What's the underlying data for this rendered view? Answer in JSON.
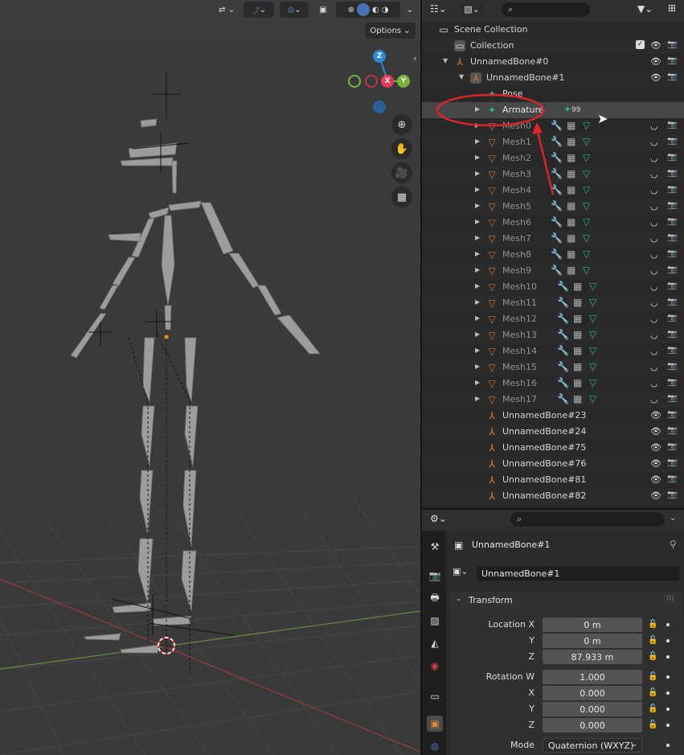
{
  "viewport": {
    "options_label": "Options",
    "gizmo": {
      "z": "Z",
      "x": "X",
      "y": "Y"
    },
    "nav_icons": [
      "zoom-icon",
      "hand-pan-icon",
      "camera-icon",
      "grid-ortho-icon"
    ]
  },
  "outliner": {
    "search_placeholder": "",
    "rows": [
      {
        "label": "Scene Collection",
        "type": "scene-collection",
        "indent": 0,
        "expander": "",
        "eye": false,
        "cam": false,
        "check": false,
        "dim": false
      },
      {
        "label": "Collection",
        "type": "collection",
        "indent": 1,
        "expander": "",
        "eye": true,
        "cam": true,
        "check": true,
        "dim": false
      },
      {
        "label": "UnnamedBone#0",
        "type": "empty",
        "indent": 1,
        "expander": "▼",
        "eye": true,
        "cam": true,
        "check": false,
        "dim": false
      },
      {
        "label": "UnnamedBone#1",
        "type": "armature-object",
        "indent": 2,
        "expander": "▼",
        "eye": true,
        "cam": true,
        "check": false,
        "dim": false
      },
      {
        "label": "Pose",
        "type": "pose",
        "indent": 3,
        "expander": "",
        "eye": false,
        "cam": false,
        "check": false,
        "dim": false
      },
      {
        "label": "Armature",
        "type": "armature-data",
        "indent": 3,
        "expander": "▶",
        "eye": false,
        "cam": false,
        "check": false,
        "dim": false,
        "selected": true,
        "suffix": "99"
      },
      {
        "label": "Mesh0",
        "type": "mesh",
        "indent": 3,
        "expander": "▶",
        "eye": "hidden",
        "cam": true,
        "dim": true
      },
      {
        "label": "Mesh1",
        "type": "mesh",
        "indent": 3,
        "expander": "▶",
        "eye": "hidden",
        "cam": true,
        "dim": true
      },
      {
        "label": "Mesh2",
        "type": "mesh",
        "indent": 3,
        "expander": "▶",
        "eye": "hidden",
        "cam": true,
        "dim": true
      },
      {
        "label": "Mesh3",
        "type": "mesh",
        "indent": 3,
        "expander": "▶",
        "eye": "hidden",
        "cam": true,
        "dim": true
      },
      {
        "label": "Mesh4",
        "type": "mesh",
        "indent": 3,
        "expander": "▶",
        "eye": "hidden",
        "cam": true,
        "dim": true
      },
      {
        "label": "Mesh5",
        "type": "mesh",
        "indent": 3,
        "expander": "▶",
        "eye": "hidden",
        "cam": true,
        "dim": true
      },
      {
        "label": "Mesh6",
        "type": "mesh",
        "indent": 3,
        "expander": "▶",
        "eye": "hidden",
        "cam": true,
        "dim": true
      },
      {
        "label": "Mesh7",
        "type": "mesh",
        "indent": 3,
        "expander": "▶",
        "eye": "hidden",
        "cam": true,
        "dim": true
      },
      {
        "label": "Mesh8",
        "type": "mesh",
        "indent": 3,
        "expander": "▶",
        "eye": "hidden",
        "cam": true,
        "dim": true
      },
      {
        "label": "Mesh9",
        "type": "mesh",
        "indent": 3,
        "expander": "▶",
        "eye": "hidden",
        "cam": true,
        "dim": true
      },
      {
        "label": "Mesh10",
        "type": "mesh",
        "indent": 3,
        "expander": "▶",
        "eye": "hidden",
        "cam": true,
        "dim": true
      },
      {
        "label": "Mesh11",
        "type": "mesh",
        "indent": 3,
        "expander": "▶",
        "eye": "hidden",
        "cam": true,
        "dim": true
      },
      {
        "label": "Mesh12",
        "type": "mesh",
        "indent": 3,
        "expander": "▶",
        "eye": "hidden",
        "cam": true,
        "dim": true
      },
      {
        "label": "Mesh13",
        "type": "mesh",
        "indent": 3,
        "expander": "▶",
        "eye": "hidden",
        "cam": true,
        "dim": true
      },
      {
        "label": "Mesh14",
        "type": "mesh",
        "indent": 3,
        "expander": "▶",
        "eye": "hidden",
        "cam": true,
        "dim": true
      },
      {
        "label": "Mesh15",
        "type": "mesh",
        "indent": 3,
        "expander": "▶",
        "eye": "hidden",
        "cam": true,
        "dim": true
      },
      {
        "label": "Mesh16",
        "type": "mesh",
        "indent": 3,
        "expander": "▶",
        "eye": "hidden",
        "cam": true,
        "dim": true
      },
      {
        "label": "Mesh17",
        "type": "mesh",
        "indent": 3,
        "expander": "▶",
        "eye": "hidden",
        "cam": true,
        "dim": true
      },
      {
        "label": "UnnamedBone#23",
        "type": "empty",
        "indent": 3,
        "expander": "",
        "eye": true,
        "cam": true,
        "dim": false
      },
      {
        "label": "UnnamedBone#24",
        "type": "empty",
        "indent": 3,
        "expander": "",
        "eye": true,
        "cam": true,
        "dim": false
      },
      {
        "label": "UnnamedBone#75",
        "type": "empty",
        "indent": 3,
        "expander": "",
        "eye": true,
        "cam": true,
        "dim": false
      },
      {
        "label": "UnnamedBone#76",
        "type": "empty",
        "indent": 3,
        "expander": "",
        "eye": true,
        "cam": true,
        "dim": false
      },
      {
        "label": "UnnamedBone#81",
        "type": "empty",
        "indent": 3,
        "expander": "",
        "eye": true,
        "cam": true,
        "dim": false
      },
      {
        "label": "UnnamedBone#82",
        "type": "empty",
        "indent": 3,
        "expander": "",
        "eye": true,
        "cam": true,
        "dim": false
      }
    ]
  },
  "properties": {
    "search_placeholder": "",
    "object_name": "UnnamedBone#1",
    "name_field": "UnnamedBone#1",
    "panel_title": "Transform",
    "location": {
      "label": "Location X",
      "x": "0 m",
      "y": "0 m",
      "z": "87.933 m"
    },
    "rotation": {
      "label": "Rotation W",
      "w": "1.000",
      "x": "0.000",
      "y": "0.000",
      "z": "0.000"
    },
    "axis_labels": {
      "y": "Y",
      "z": "Z",
      "x": "X"
    },
    "mode_label": "Mode",
    "mode_value": "Quaternion (WXYZ)"
  },
  "colors": {
    "accent_blue": "#4772b3",
    "gizmo_x": "#e83a5a",
    "gizmo_y": "#7ab33c",
    "gizmo_z": "#2f87d6",
    "armature_green": "#30b38f",
    "bone_orange": "#e0893d",
    "mesh_orange": "#d9782f",
    "annotation_red": "#d8252a"
  }
}
